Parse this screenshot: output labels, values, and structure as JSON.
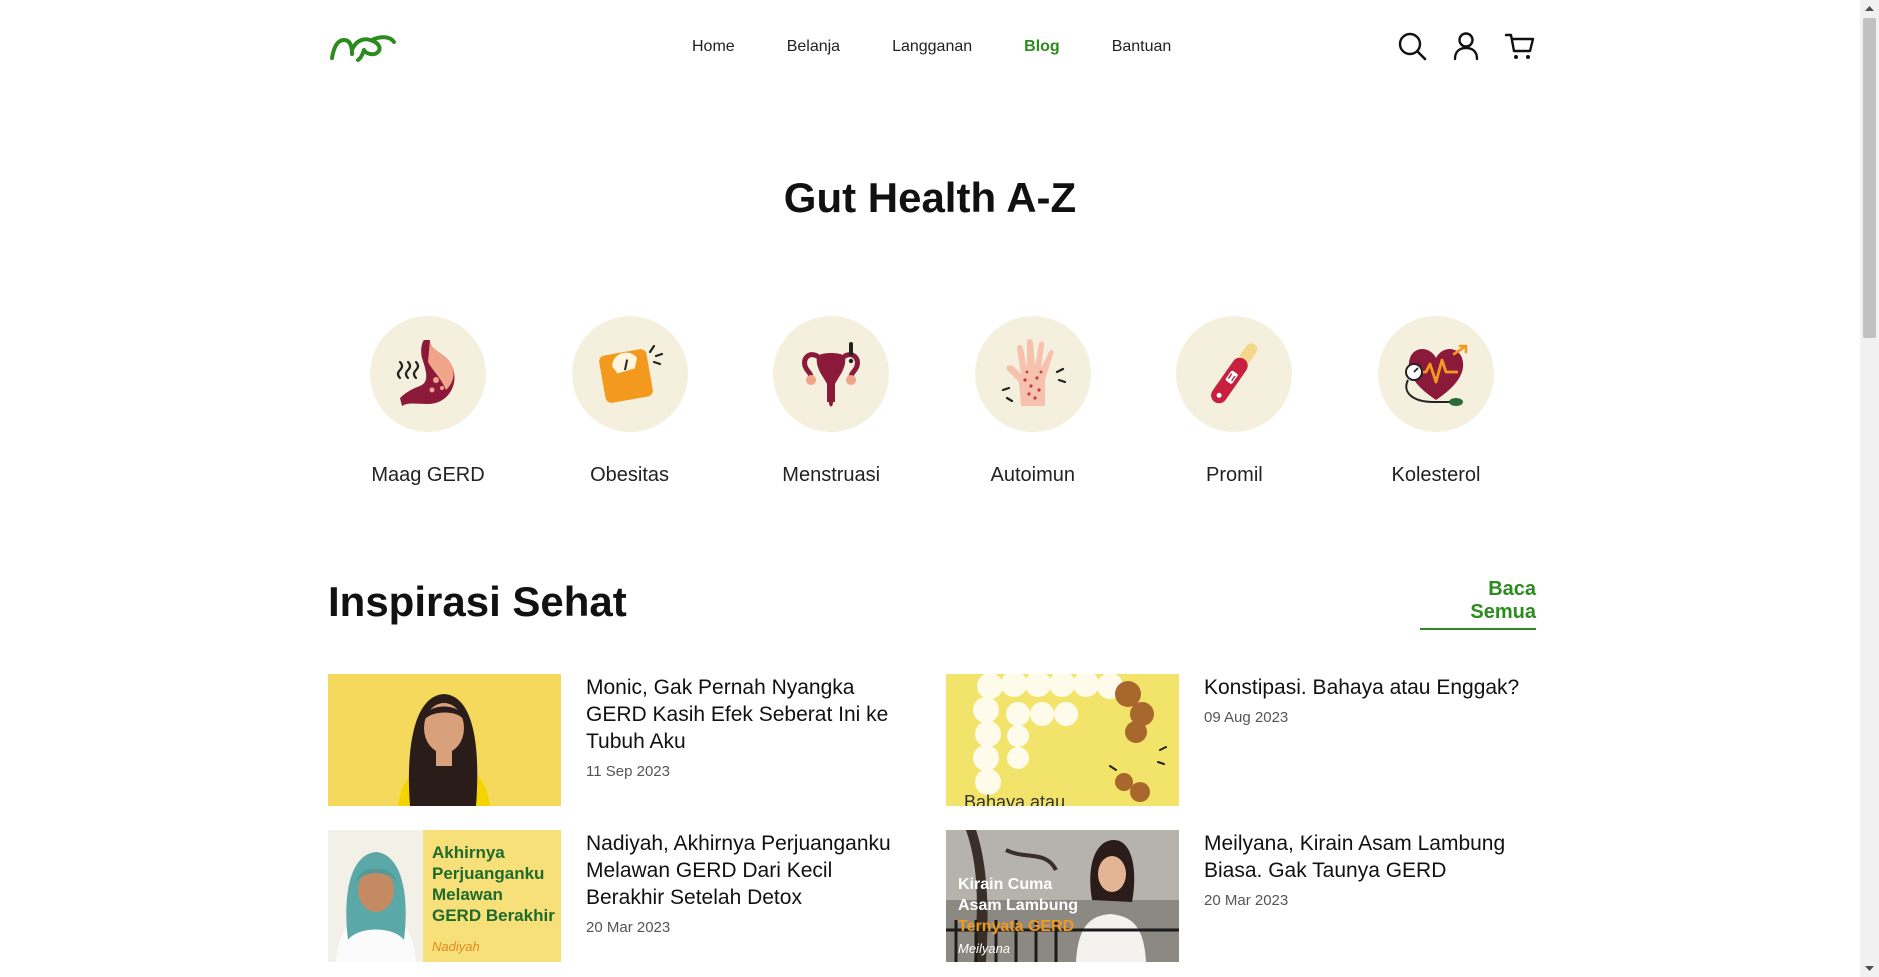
{
  "nav": {
    "items": [
      {
        "label": "Home"
      },
      {
        "label": "Belanja"
      },
      {
        "label": "Langganan"
      },
      {
        "label": "Blog"
      },
      {
        "label": "Bantuan"
      }
    ]
  },
  "colors": {
    "brand": "#2d8a1e",
    "circle_bg": "#f5f0de",
    "thumb_yellow": "#f7df6a",
    "maroon": "#8b1a3a"
  },
  "gut_health": {
    "title": "Gut Health A-Z",
    "categories": [
      {
        "label": "Maag GERD",
        "icon": "stomach-icon"
      },
      {
        "label": "Obesitas",
        "icon": "scale-icon"
      },
      {
        "label": "Menstruasi",
        "icon": "uterus-icon"
      },
      {
        "label": "Autoimun",
        "icon": "hand-rash-icon"
      },
      {
        "label": "Promil",
        "icon": "pregnancy-test-icon"
      },
      {
        "label": "Kolesterol",
        "icon": "heart-pressure-icon"
      }
    ]
  },
  "inspirasi": {
    "title": "Inspirasi Sehat",
    "read_all": "Baca Semua",
    "articles": [
      {
        "title": "Monic, Gak Pernah Nyangka GERD Kasih Efek Seberat Ini ke Tubuh Aku",
        "date": "11 Sep 2023"
      },
      {
        "title": "Konstipasi. Bahaya atau Enggak?",
        "date": "09 Aug 2023",
        "thumb_text": "Bahaya atau"
      },
      {
        "title": "Nadiyah, Akhirnya Perjuanganku Melawan GERD Dari Kecil Berakhir Setelah Detox",
        "date": "20 Mar 2023",
        "thumb_text": "Akhirnya Perjuanganku Melawan GERD Berakhir",
        "thumb_sign": "Nadiyah"
      },
      {
        "title": "Meilyana, Kirain Asam Lambung Biasa. Gak Taunya GERD",
        "date": "20 Mar 2023",
        "thumb_text_1": "Kirain Cuma Asam Lambung",
        "thumb_text_2": "Ternyata GERD",
        "thumb_sign": "Meilyana"
      }
    ]
  }
}
